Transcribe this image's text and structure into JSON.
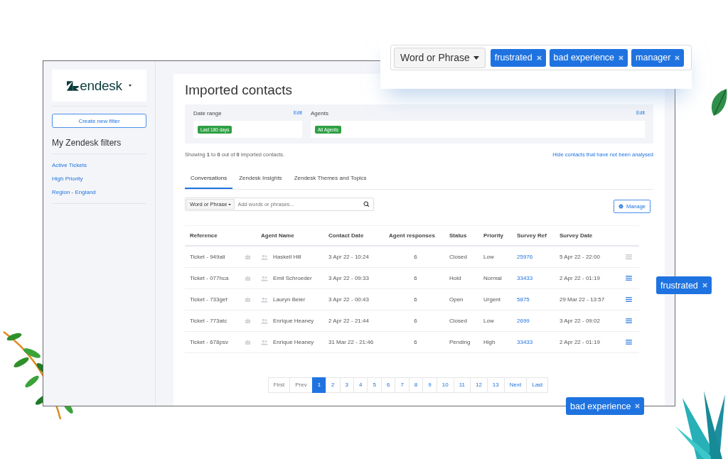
{
  "sidebar": {
    "logo": "endesk",
    "create_button": "Create new filter",
    "heading": "My Zendesk filters",
    "filters": [
      "Active Tickets",
      "High Priority",
      "Region - England"
    ]
  },
  "main": {
    "title": "Imported contacts",
    "filters": [
      {
        "label": "Date range",
        "edit": "Edit",
        "badge": "Last 180 days"
      },
      {
        "label": "Agents",
        "edit": "Edit",
        "badge": "All Agents"
      }
    ],
    "showing": "Showing **1** to **0** out of **0** imported contacts.",
    "hide_link": "Hide contacts that have not been analysed",
    "tabs": [
      {
        "label": "Conversations",
        "selected": true
      },
      {
        "label": "Zendesk Insights",
        "selected": false
      },
      {
        "label": "Zendesk Themes and Topics",
        "selected": false
      }
    ],
    "search": {
      "type": "Word or Phrase",
      "placeholder": "Add words or phrases..."
    },
    "manage_button": "Manage",
    "table": {
      "columns": [
        "Reference",
        "Agent Name",
        "Contact Date",
        "Agent responses",
        "Status",
        "Priority",
        "Survey Ref",
        "Survey Date"
      ],
      "rows": [
        {
          "reference": "Ticket - 949ali",
          "agent": "Haskell Hill",
          "contact_date": "3 Apr 22 - 10:24",
          "responses": "6",
          "status": "Closed",
          "priority": "Low",
          "survey_ref": "25976",
          "survey_date": "5 Apr 22 - 22:00",
          "menu_active": false
        },
        {
          "reference": "Ticket - 077hca",
          "agent": "Emil Schroeder",
          "contact_date": "3 Apr 22 - 09:33",
          "responses": "6",
          "status": "Hold",
          "priority": "Normal",
          "survey_ref": "33433",
          "survey_date": "2 Apr 22 - 01:19",
          "menu_active": true
        },
        {
          "reference": "Ticket - 733gef",
          "agent": "Lauryn Beier",
          "contact_date": "3 Apr 22 - 00:43",
          "responses": "6",
          "status": "Open",
          "priority": "Urgent",
          "survey_ref": "5875",
          "survey_date": "29 Mar 22 - 13:57",
          "menu_active": true
        },
        {
          "reference": "Ticket - 773atc",
          "agent": "Enrique Heaney",
          "contact_date": "2 Apr 22 - 21:44",
          "responses": "6",
          "status": "Closed",
          "priority": "Low",
          "survey_ref": "2699",
          "survey_date": "3 Apr 22 - 09:02",
          "menu_active": true
        },
        {
          "reference": "Ticket - 678psv",
          "agent": "Enrique Heaney",
          "contact_date": "31 Mar 22 - 21:46",
          "responses": "6",
          "status": "Pending",
          "priority": "High",
          "survey_ref": "33433",
          "survey_date": "2 Apr 22 - 01:19",
          "menu_active": true
        }
      ]
    },
    "pagination": [
      {
        "label": "First",
        "selected": false,
        "disabled": true
      },
      {
        "label": "Prev",
        "selected": false,
        "disabled": true
      },
      {
        "label": "1",
        "selected": true,
        "disabled": false
      },
      {
        "label": "2",
        "selected": false,
        "disabled": false
      },
      {
        "label": "3",
        "selected": false,
        "disabled": false
      },
      {
        "label": "4",
        "selected": false,
        "disabled": false
      },
      {
        "label": "5",
        "selected": false,
        "disabled": false
      },
      {
        "label": "6",
        "selected": false,
        "disabled": false
      },
      {
        "label": "7",
        "selected": false,
        "disabled": false
      },
      {
        "label": "8",
        "selected": false,
        "disabled": false
      },
      {
        "label": "9",
        "selected": false,
        "disabled": false
      },
      {
        "label": "10",
        "selected": false,
        "disabled": false
      },
      {
        "label": "11",
        "selected": false,
        "disabled": false
      },
      {
        "label": "12",
        "selected": false,
        "disabled": false
      },
      {
        "label": "13",
        "selected": false,
        "disabled": false
      },
      {
        "label": "Next",
        "selected": false,
        "disabled": false
      },
      {
        "label": "Last",
        "selected": false,
        "disabled": false
      }
    ]
  },
  "keyword_bar": {
    "type": "Word or Phrase",
    "tags": [
      "frustrated",
      "bad experience",
      "manager"
    ]
  },
  "floating_tags": [
    "frustrated",
    "bad experience"
  ]
}
